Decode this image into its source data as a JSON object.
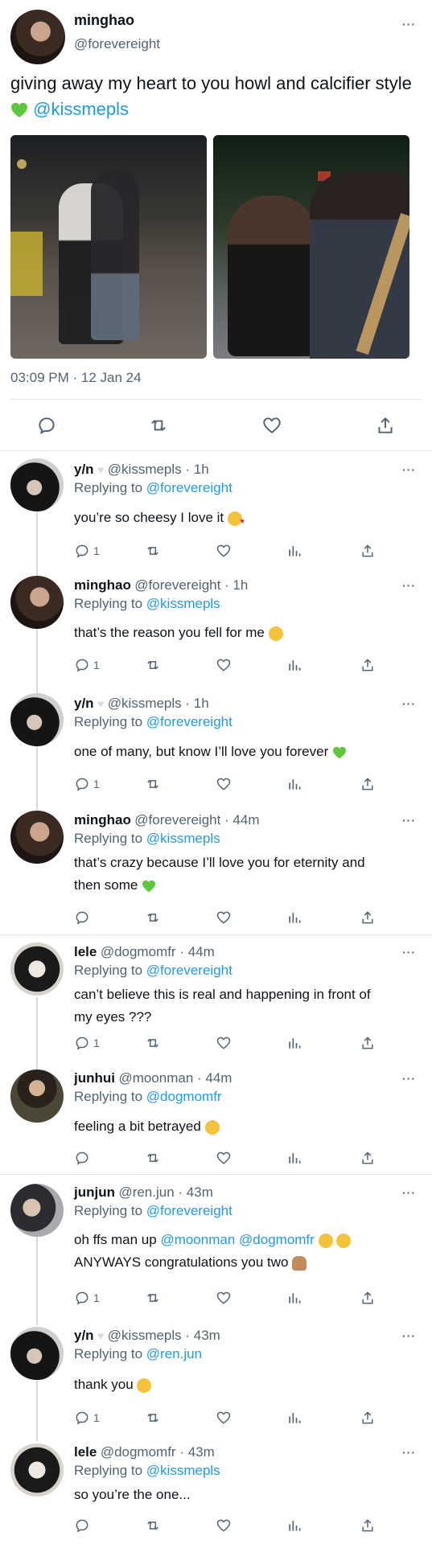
{
  "main": {
    "name": "minghao",
    "handle": "@forevereight",
    "text": "giving away my heart to you howl and calcifier style",
    "mention": "@kissmepls",
    "timestamp": "03:09 PM · 12 Jan 24"
  },
  "replies": [
    {
      "name": "y/n",
      "handle": "@kissmepls · 1h",
      "replying_to": "@forevereight",
      "line1": "you’re so cheesy I love it",
      "line2": "",
      "reply_count": "1"
    },
    {
      "name": "minghao",
      "handle": "@forevereight · 1h",
      "replying_to": "@kissmepls",
      "line1": "that’s the reason you fell for me",
      "line2": "",
      "reply_count": "1"
    },
    {
      "name": "y/n",
      "handle": "@kissmepls · 1h",
      "replying_to": "@forevereight",
      "line1": "one of many, but know I’ll love you forever",
      "line2": "",
      "reply_count": "1"
    },
    {
      "name": "minghao",
      "handle": "@forevereight · 44m",
      "replying_to": "@kissmepls",
      "line1": "that’s crazy because I’ll love you for eternity and",
      "line2": "then some",
      "reply_count": ""
    },
    {
      "name": "lele",
      "handle": "@dogmomfr · 44m",
      "replying_to": "@forevereight",
      "line1": "can’t believe this is real and happening in front of",
      "line2": "my eyes ???",
      "reply_count": "1"
    },
    {
      "name": "junhui",
      "handle": "@moonman · 44m",
      "replying_to": "@dogmomfr",
      "line1": "feeling a bit betrayed",
      "line2": "",
      "reply_count": ""
    },
    {
      "name": "junjun",
      "handle": "@ren.jun · 43m",
      "replying_to": "@forevereight",
      "line1_mentions": "oh ffs man up",
      "mention_a": "@moonman",
      "mention_b": "@dogmomfr",
      "line2": "ANYWAYS congratulations you two",
      "reply_count": "1"
    },
    {
      "name": "y/n",
      "handle": "@kissmepls · 43m",
      "replying_to": "@ren.jun",
      "line1": "thank you",
      "line2": "",
      "reply_count": "1"
    },
    {
      "name": "lele",
      "handle": "@dogmomfr · 43m",
      "replying_to": "@kissmepls",
      "line1": "so you’re the one...",
      "line2": "",
      "reply_count": ""
    }
  ],
  "labels": {
    "replying": "Replying to",
    "more": "···"
  },
  "colors": {
    "accent": "#1d9bf0",
    "muted": "#536471",
    "border": "#e1e6ea"
  }
}
